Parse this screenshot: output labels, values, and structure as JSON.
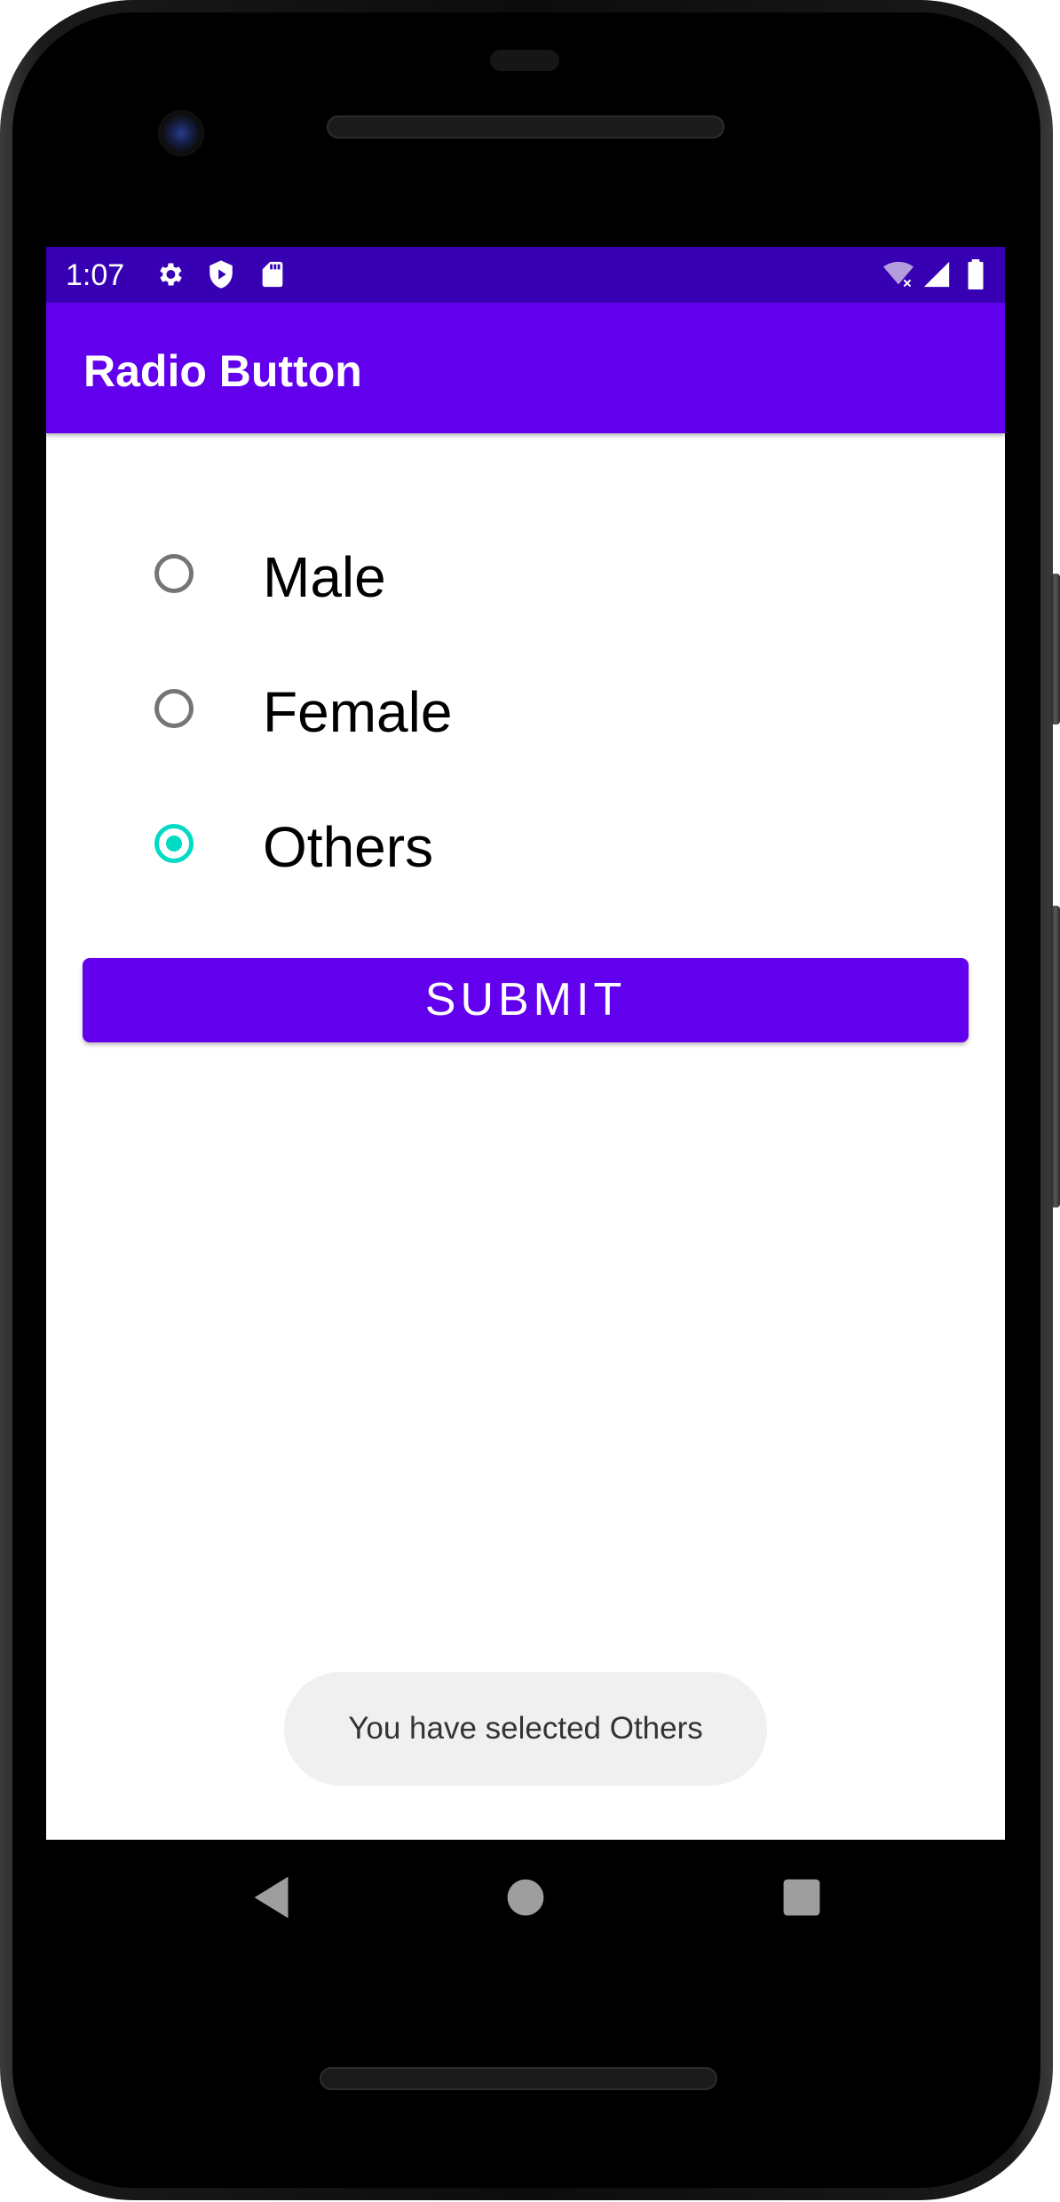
{
  "status_bar": {
    "time": "1:07",
    "icons_left": [
      "gear-icon",
      "shield-play-icon",
      "sd-card-icon"
    ],
    "icons_right": [
      "wifi-off-icon",
      "cell-signal-icon",
      "battery-icon"
    ]
  },
  "app_bar": {
    "title": "Radio Button"
  },
  "radio_group": {
    "options": [
      {
        "label": "Male",
        "checked": false
      },
      {
        "label": "Female",
        "checked": false
      },
      {
        "label": "Others",
        "checked": true
      }
    ]
  },
  "submit": {
    "label": "SUBMIT"
  },
  "toast": {
    "message": "You have selected Others"
  },
  "nav_bar": {
    "buttons": [
      "back-icon",
      "home-icon",
      "recents-icon"
    ]
  },
  "colors": {
    "primary": "#6200ee",
    "primary_dark": "#3700b3",
    "accent": "#03dac5",
    "radio_unchecked": "#757575",
    "toast_bg": "#f0f0f0"
  }
}
